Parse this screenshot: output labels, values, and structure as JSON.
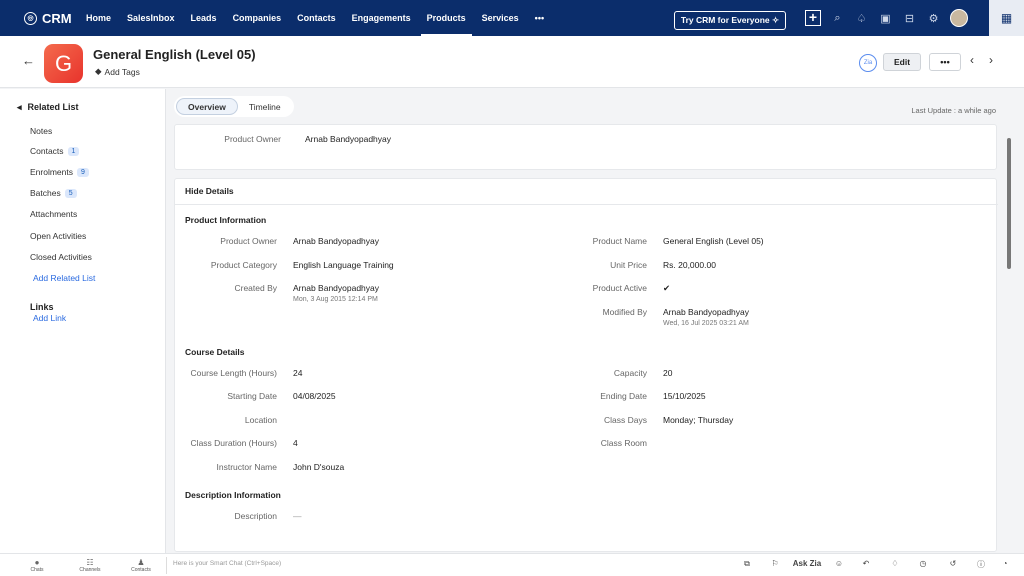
{
  "app": {
    "name": "CRM"
  },
  "nav": {
    "items": [
      "Home",
      "SalesInbox",
      "Leads",
      "Companies",
      "Contacts",
      "Engagements",
      "Products",
      "Services"
    ],
    "more": "•••"
  },
  "topbar": {
    "try_label": "Try CRM for Everyone ✧",
    "plus": "+"
  },
  "header": {
    "title": "General English (Level 05)",
    "avatar_letter": "G",
    "add_tags": "Add Tags",
    "edit": "Edit",
    "more": "•••"
  },
  "sidebar": {
    "title": "Related List",
    "items": [
      {
        "label": "Notes",
        "count": ""
      },
      {
        "label": "Contacts",
        "count": "1"
      },
      {
        "label": "Enrolments",
        "count": "9"
      },
      {
        "label": "Batches",
        "count": "5"
      },
      {
        "label": "Attachments",
        "count": ""
      },
      {
        "label": "Open Activities",
        "count": ""
      },
      {
        "label": "Closed Activities",
        "count": ""
      }
    ],
    "add_related": "Add Related List",
    "links_title": "Links",
    "add_link": "Add Link"
  },
  "tabs": {
    "overview": "Overview",
    "timeline": "Timeline",
    "last_update": "Last Update : a while ago"
  },
  "summary": {
    "owner_label": "Product Owner",
    "owner_value": "Arnab Bandyopadhyay"
  },
  "details": {
    "hide": "Hide Details",
    "product_info": "Product Information",
    "left": [
      {
        "l": "Product Owner",
        "v": "Arnab Bandyopadhyay"
      },
      {
        "l": "Product Category",
        "v": "English Language Training"
      },
      {
        "l": "Created By",
        "v": "Arnab Bandyopadhyay",
        "sub": "Mon, 3 Aug 2015 12:14 PM"
      }
    ],
    "right": [
      {
        "l": "Product Name",
        "v": "General English (Level 05)"
      },
      {
        "l": "Unit Price",
        "v": "Rs. 20,000.00"
      },
      {
        "l": "Product Active",
        "v": "✔"
      },
      {
        "l": "Modified By",
        "v": "Arnab Bandyopadhyay",
        "sub": "Wed, 16 Jul 2025 03:21 AM"
      }
    ],
    "course_title": "Course Details",
    "course_left": [
      {
        "l": "Course Length (Hours)",
        "v": "24"
      },
      {
        "l": "Starting Date",
        "v": "04/08/2025"
      },
      {
        "l": "Location",
        "v": ""
      },
      {
        "l": "Class Duration (Hours)",
        "v": "4"
      },
      {
        "l": "Instructor Name",
        "v": "John D'souza"
      }
    ],
    "course_right": [
      {
        "l": "Capacity",
        "v": "20"
      },
      {
        "l": "Ending Date",
        "v": "15/10/2025"
      },
      {
        "l": "Class Days",
        "v": "Monday; Thursday"
      },
      {
        "l": "Class Room",
        "v": ""
      }
    ],
    "desc_title": "Description Information",
    "desc_label": "Description",
    "desc_value": "—"
  },
  "bottom": {
    "chats": "Chats",
    "channels": "Channels",
    "contacts": "Contacts",
    "chat_placeholder": "Here is your Smart Chat (Ctrl+Space)",
    "ask_zia": "Ask Zia"
  }
}
